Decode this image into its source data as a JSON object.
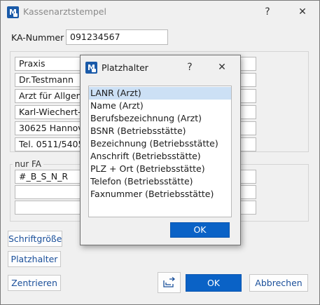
{
  "window": {
    "title": "Kassenarztstempel",
    "help_label": "?",
    "close_label": "✕"
  },
  "ka_nummer": {
    "label": "KA-Nummer",
    "value": "091234567"
  },
  "stempel_lines": [
    "Praxis",
    "Dr.Testmann",
    "Arzt für Allgeme",
    "Karl-Wiechert-A",
    "30625 Hannove",
    "Tel. 0511/5405-"
  ],
  "fa_group": {
    "title": "nur FA",
    "lines": [
      "#_B_S_N_R",
      "",
      ""
    ]
  },
  "buttons": {
    "schriftgroesse": "Schriftgröße",
    "platzhalter": "Platzhalter",
    "zentrieren": "Zentrieren",
    "ok": "OK",
    "abbrechen": "Abbrechen"
  },
  "dialog": {
    "title": "Platzhalter",
    "help_label": "?",
    "close_label": "✕",
    "items": [
      "LANR (Arzt)",
      "Name (Arzt)",
      "Berufsbezeichnung (Arzt)",
      "BSNR (Betriebsstätte)",
      "Bezeichnung (Betriebsstätte)",
      "Anschrift (Betriebsstätte)",
      "PLZ + Ort (Betriebsstätte)",
      "Telefon (Betriebsstätte)",
      "Faxnummer (Betriebsstätte)"
    ],
    "selected_index": 0,
    "ok_label": "OK"
  },
  "icons": {
    "app": "app-logo-icon",
    "export": "export-icon"
  },
  "colors": {
    "accent": "#0a62c6",
    "selection": "#cce0f5",
    "link_text": "#1a4f9a"
  }
}
